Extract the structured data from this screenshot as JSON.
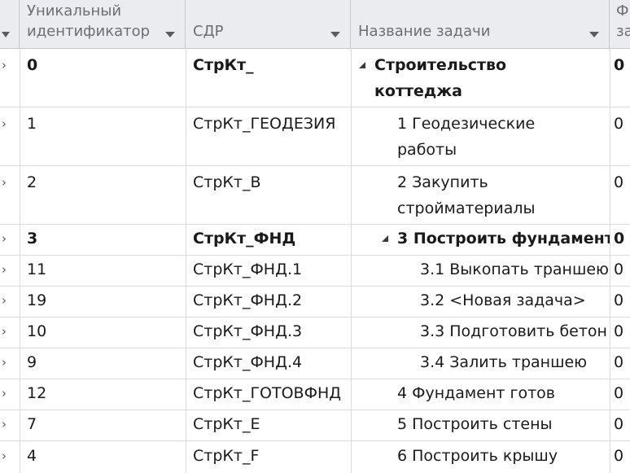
{
  "columns": {
    "id": "Уникальный\nидентификатор",
    "wbs": "СДР",
    "name": "Название задачи",
    "next": "Ф\nза"
  },
  "rows": [
    {
      "id": "0",
      "wbs": "СтрКт_",
      "name_line1": "Строительство",
      "name_line2": "коттеджа",
      "edge": "0"
    },
    {
      "id": "1",
      "wbs": "СтрКт_ГЕОДЕЗИЯ",
      "name_line1": "1 Геодезические",
      "name_line2": "работы",
      "edge": "0"
    },
    {
      "id": "2",
      "wbs": "СтрКт_В",
      "name_line1": "2 Закупить",
      "name_line2": "стройматериалы",
      "edge": "0"
    },
    {
      "id": "3",
      "wbs": "СтрКт_ФНД",
      "name_line1": "3 Построить фундамент",
      "edge": "0"
    },
    {
      "id": "11",
      "wbs": "СтрКт_ФНД.1",
      "name_line1": "3.1 Выкопать траншею",
      "edge": "0"
    },
    {
      "id": "19",
      "wbs": "СтрКт_ФНД.2",
      "name_line1": "3.2 <Новая задача>",
      "edge": "0"
    },
    {
      "id": "10",
      "wbs": "СтрКт_ФНД.3",
      "name_line1": "3.3 Подготовить бетон",
      "edge": "0"
    },
    {
      "id": "9",
      "wbs": "СтрКт_ФНД.4",
      "name_line1": "3.4 Залить траншею",
      "edge": "0"
    },
    {
      "id": "12",
      "wbs": "СтрКт_ГОТОВФНД",
      "name_line1": "4 Фундамент готов",
      "edge": "0"
    },
    {
      "id": "7",
      "wbs": "СтрКт_Е",
      "name_line1": "5 Построить стены",
      "edge": "0"
    },
    {
      "id": "4",
      "wbs": "СтрКт_F",
      "name_line1": "6 Построить крышу",
      "edge": "0"
    }
  ]
}
